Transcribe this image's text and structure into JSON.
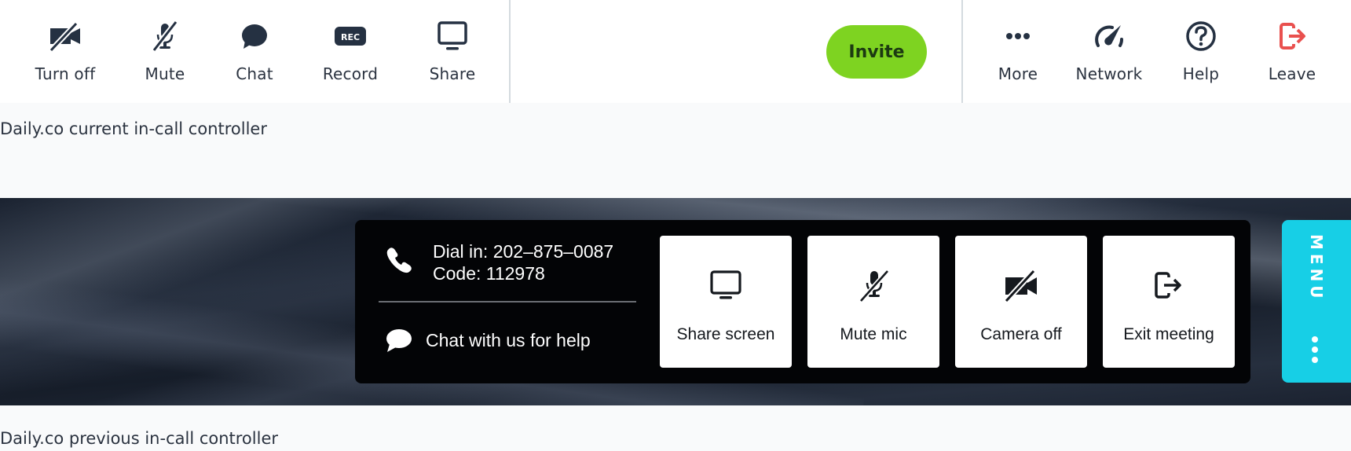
{
  "current_controller": {
    "left_items": [
      {
        "label": "Turn off",
        "icon": "camera-off-icon"
      },
      {
        "label": "Mute",
        "icon": "mic-off-icon"
      },
      {
        "label": "Chat",
        "icon": "chat-bubble-icon"
      },
      {
        "label": "Record",
        "icon": "rec-icon",
        "icon_text": "REC"
      },
      {
        "label": "Share",
        "icon": "monitor-icon"
      }
    ],
    "invite_label": "Invite",
    "right_items": [
      {
        "label": "More",
        "icon": "more-dots-icon"
      },
      {
        "label": "Network",
        "icon": "speedometer-icon"
      },
      {
        "label": "Help",
        "icon": "help-circle-icon"
      },
      {
        "label": "Leave",
        "icon": "leave-icon"
      }
    ],
    "colors": {
      "invite": "#7ed321",
      "leave": "#e9504e",
      "icon": "#253142"
    }
  },
  "captions": {
    "current": "Daily.co current in-call controller",
    "previous": "Daily.co previous in-call controller"
  },
  "previous_controller": {
    "dial_in": "Dial in: 202–875–0087",
    "code": "Code: 112978",
    "chat_help": "Chat with us for help",
    "tiles": [
      {
        "label": "Share screen",
        "icon": "monitor-icon"
      },
      {
        "label": "Mute mic",
        "icon": "mic-off-icon"
      },
      {
        "label": "Camera off",
        "icon": "camera-off-icon"
      },
      {
        "label": "Exit meeting",
        "icon": "exit-icon"
      }
    ],
    "menu_label": "MENU",
    "colors": {
      "menu": "#17cfe6",
      "panel": "#030406"
    }
  }
}
